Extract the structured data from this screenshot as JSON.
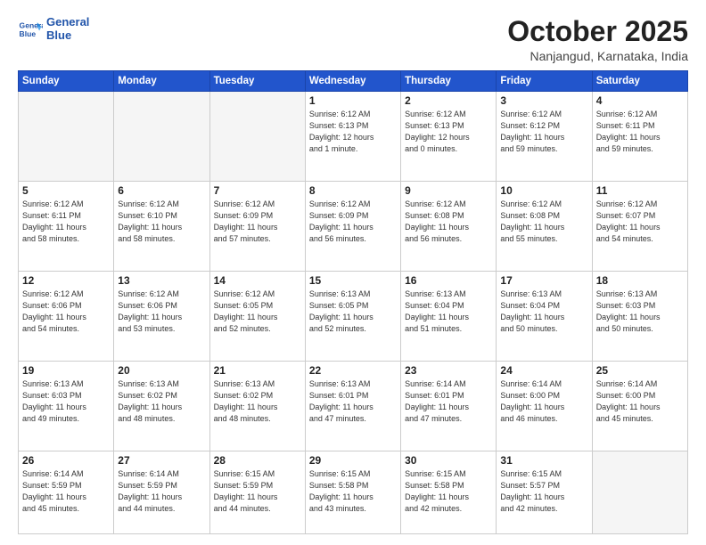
{
  "logo": {
    "line1": "General",
    "line2": "Blue"
  },
  "header": {
    "month": "October 2025",
    "location": "Nanjangud, Karnataka, India"
  },
  "weekdays": [
    "Sunday",
    "Monday",
    "Tuesday",
    "Wednesday",
    "Thursday",
    "Friday",
    "Saturday"
  ],
  "weeks": [
    [
      {
        "day": "",
        "info": ""
      },
      {
        "day": "",
        "info": ""
      },
      {
        "day": "",
        "info": ""
      },
      {
        "day": "1",
        "info": "Sunrise: 6:12 AM\nSunset: 6:13 PM\nDaylight: 12 hours\nand 1 minute."
      },
      {
        "day": "2",
        "info": "Sunrise: 6:12 AM\nSunset: 6:13 PM\nDaylight: 12 hours\nand 0 minutes."
      },
      {
        "day": "3",
        "info": "Sunrise: 6:12 AM\nSunset: 6:12 PM\nDaylight: 11 hours\nand 59 minutes."
      },
      {
        "day": "4",
        "info": "Sunrise: 6:12 AM\nSunset: 6:11 PM\nDaylight: 11 hours\nand 59 minutes."
      }
    ],
    [
      {
        "day": "5",
        "info": "Sunrise: 6:12 AM\nSunset: 6:11 PM\nDaylight: 11 hours\nand 58 minutes."
      },
      {
        "day": "6",
        "info": "Sunrise: 6:12 AM\nSunset: 6:10 PM\nDaylight: 11 hours\nand 58 minutes."
      },
      {
        "day": "7",
        "info": "Sunrise: 6:12 AM\nSunset: 6:09 PM\nDaylight: 11 hours\nand 57 minutes."
      },
      {
        "day": "8",
        "info": "Sunrise: 6:12 AM\nSunset: 6:09 PM\nDaylight: 11 hours\nand 56 minutes."
      },
      {
        "day": "9",
        "info": "Sunrise: 6:12 AM\nSunset: 6:08 PM\nDaylight: 11 hours\nand 56 minutes."
      },
      {
        "day": "10",
        "info": "Sunrise: 6:12 AM\nSunset: 6:08 PM\nDaylight: 11 hours\nand 55 minutes."
      },
      {
        "day": "11",
        "info": "Sunrise: 6:12 AM\nSunset: 6:07 PM\nDaylight: 11 hours\nand 54 minutes."
      }
    ],
    [
      {
        "day": "12",
        "info": "Sunrise: 6:12 AM\nSunset: 6:06 PM\nDaylight: 11 hours\nand 54 minutes."
      },
      {
        "day": "13",
        "info": "Sunrise: 6:12 AM\nSunset: 6:06 PM\nDaylight: 11 hours\nand 53 minutes."
      },
      {
        "day": "14",
        "info": "Sunrise: 6:12 AM\nSunset: 6:05 PM\nDaylight: 11 hours\nand 52 minutes."
      },
      {
        "day": "15",
        "info": "Sunrise: 6:13 AM\nSunset: 6:05 PM\nDaylight: 11 hours\nand 52 minutes."
      },
      {
        "day": "16",
        "info": "Sunrise: 6:13 AM\nSunset: 6:04 PM\nDaylight: 11 hours\nand 51 minutes."
      },
      {
        "day": "17",
        "info": "Sunrise: 6:13 AM\nSunset: 6:04 PM\nDaylight: 11 hours\nand 50 minutes."
      },
      {
        "day": "18",
        "info": "Sunrise: 6:13 AM\nSunset: 6:03 PM\nDaylight: 11 hours\nand 50 minutes."
      }
    ],
    [
      {
        "day": "19",
        "info": "Sunrise: 6:13 AM\nSunset: 6:03 PM\nDaylight: 11 hours\nand 49 minutes."
      },
      {
        "day": "20",
        "info": "Sunrise: 6:13 AM\nSunset: 6:02 PM\nDaylight: 11 hours\nand 48 minutes."
      },
      {
        "day": "21",
        "info": "Sunrise: 6:13 AM\nSunset: 6:02 PM\nDaylight: 11 hours\nand 48 minutes."
      },
      {
        "day": "22",
        "info": "Sunrise: 6:13 AM\nSunset: 6:01 PM\nDaylight: 11 hours\nand 47 minutes."
      },
      {
        "day": "23",
        "info": "Sunrise: 6:14 AM\nSunset: 6:01 PM\nDaylight: 11 hours\nand 47 minutes."
      },
      {
        "day": "24",
        "info": "Sunrise: 6:14 AM\nSunset: 6:00 PM\nDaylight: 11 hours\nand 46 minutes."
      },
      {
        "day": "25",
        "info": "Sunrise: 6:14 AM\nSunset: 6:00 PM\nDaylight: 11 hours\nand 45 minutes."
      }
    ],
    [
      {
        "day": "26",
        "info": "Sunrise: 6:14 AM\nSunset: 5:59 PM\nDaylight: 11 hours\nand 45 minutes."
      },
      {
        "day": "27",
        "info": "Sunrise: 6:14 AM\nSunset: 5:59 PM\nDaylight: 11 hours\nand 44 minutes."
      },
      {
        "day": "28",
        "info": "Sunrise: 6:15 AM\nSunset: 5:59 PM\nDaylight: 11 hours\nand 44 minutes."
      },
      {
        "day": "29",
        "info": "Sunrise: 6:15 AM\nSunset: 5:58 PM\nDaylight: 11 hours\nand 43 minutes."
      },
      {
        "day": "30",
        "info": "Sunrise: 6:15 AM\nSunset: 5:58 PM\nDaylight: 11 hours\nand 42 minutes."
      },
      {
        "day": "31",
        "info": "Sunrise: 6:15 AM\nSunset: 5:57 PM\nDaylight: 11 hours\nand 42 minutes."
      },
      {
        "day": "",
        "info": ""
      }
    ]
  ]
}
